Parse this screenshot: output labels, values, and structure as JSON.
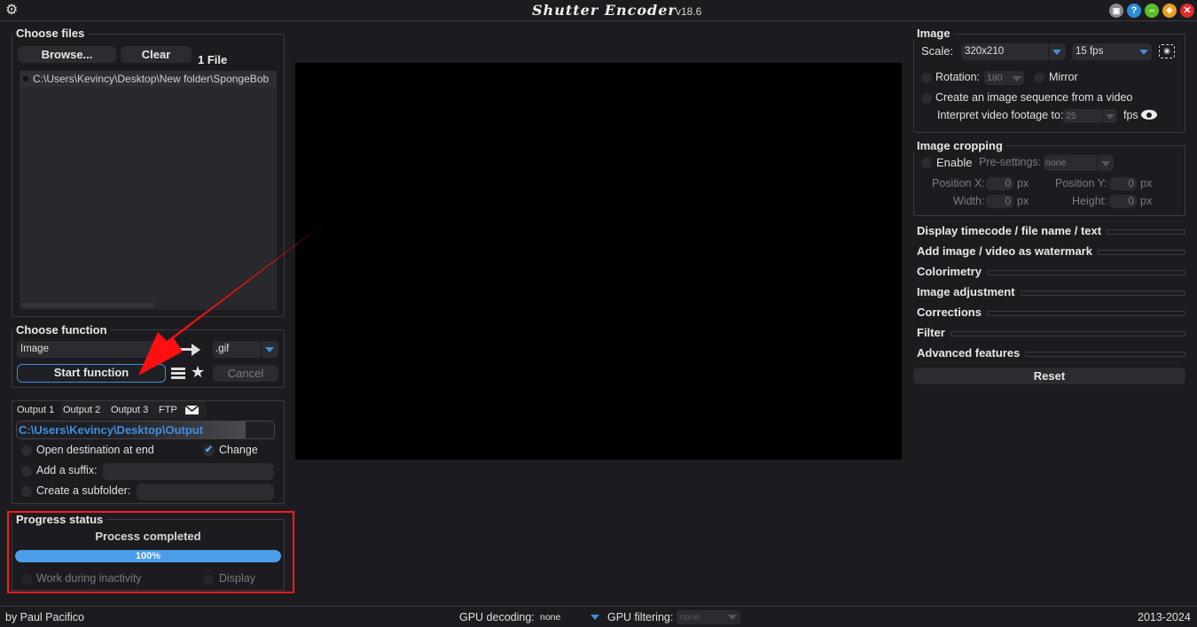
{
  "window": {
    "title": "Shutter Encoder",
    "version": "v18.6",
    "controls": [
      "restore",
      "help",
      "minimize",
      "maximize",
      "close"
    ]
  },
  "choose_files": {
    "title": "Choose files",
    "browse_label": "Browse...",
    "clear_label": "Clear",
    "file_count": "1 File",
    "files": [
      "C:\\Users\\Kevincy\\Desktop\\New folder\\SpongeBob"
    ]
  },
  "choose_function": {
    "title": "Choose function",
    "function_value": "Image",
    "format_value": ".gif",
    "start_label": "Start function",
    "cancel_label": "Cancel"
  },
  "output": {
    "tabs": [
      "Output 1",
      "Output 2",
      "Output 3",
      "FTP"
    ],
    "path": "C:\\Users\\Kevincy\\Desktop\\Output",
    "open_destination_label": "Open destination at end",
    "change_label": "Change",
    "change_checked": true,
    "suffix_label": "Add a suffix:",
    "suffix_value": "",
    "subfolder_label": "Create a subfolder:",
    "subfolder_value": ""
  },
  "progress": {
    "title": "Progress status",
    "status_text": "Process completed",
    "percent_label": "100%",
    "percent": 100,
    "work_inactivity_label": "Work during inactivity",
    "display_label": "Display"
  },
  "image_settings": {
    "title": "Image",
    "scale_label": "Scale:",
    "scale_value": "320x210",
    "fps_value": "15 fps",
    "rotation_label": "Rotation:",
    "rotation_value": "180",
    "mirror_label": "Mirror",
    "sequence_label": "Create an image sequence from a video",
    "interpret_label": "Interpret video footage to:",
    "interpret_value": "25",
    "interpret_unit": "fps"
  },
  "cropping": {
    "title": "Image cropping",
    "enable_label": "Enable",
    "presettings_label": "Pre-settings:",
    "presettings_value": "none",
    "pos_x_label": "Position X:",
    "pos_x_value": "0",
    "pos_y_label": "Position Y:",
    "pos_y_value": "0",
    "width_label": "Width:",
    "width_value": "0",
    "height_label": "Height:",
    "height_value": "0",
    "unit": "px"
  },
  "sections": [
    "Display timecode / file name / text",
    "Add image / video as watermark",
    "Colorimetry",
    "Image adjustment",
    "Corrections",
    "Filter",
    "Advanced features"
  ],
  "reset_label": "Reset",
  "statusbar": {
    "author": "by Paul Pacifico",
    "gpu_decoding_label": "GPU decoding:",
    "gpu_decoding_value": "none",
    "gpu_filtering_label": "GPU filtering:",
    "gpu_filtering_value": "none",
    "years": "2013-2024"
  },
  "colors": {
    "accent": "#3d8fe0",
    "progress_fill": "#4a9ee8",
    "annotation": "#ff1a1a",
    "background": "#1c1c20"
  }
}
